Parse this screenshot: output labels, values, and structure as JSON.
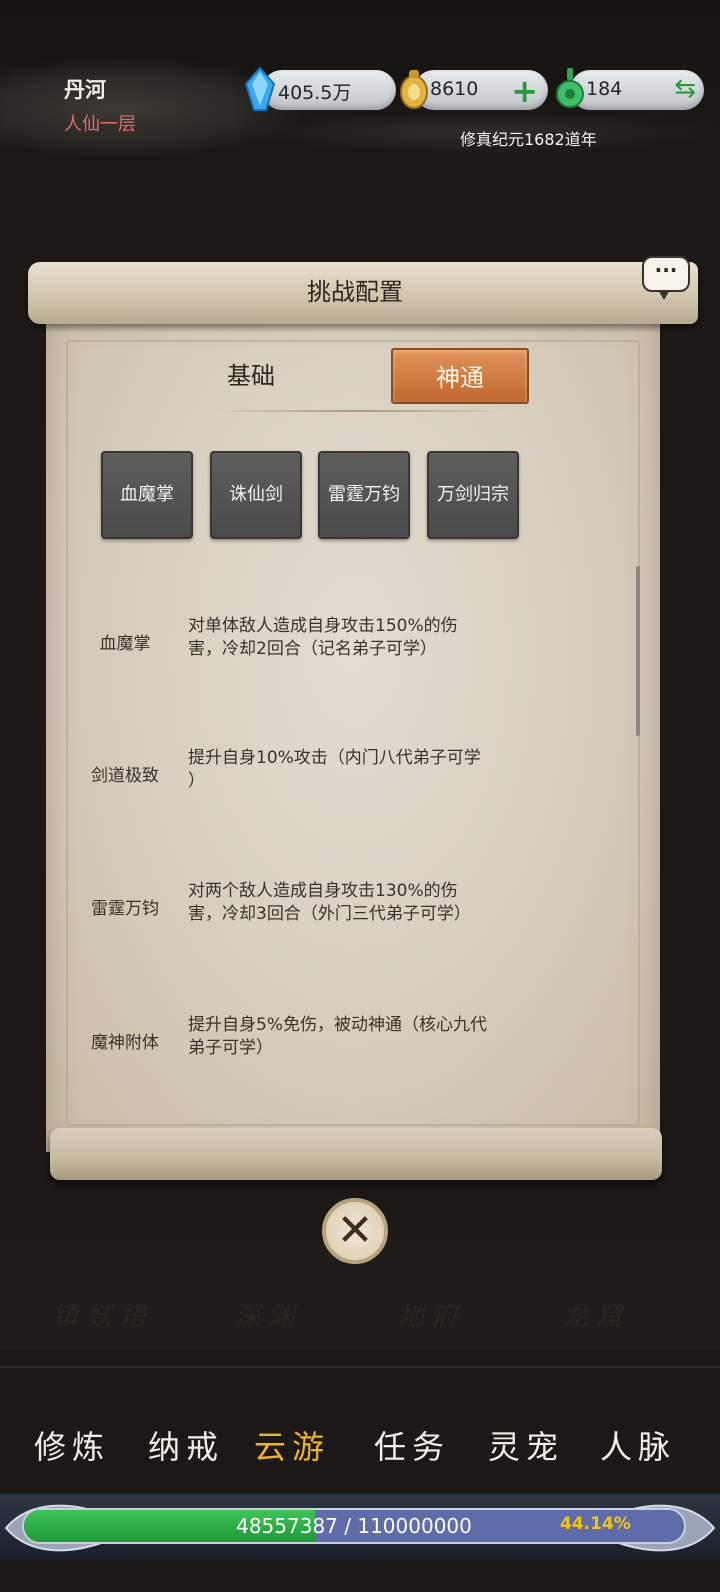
{
  "header": {
    "player_name": "丹河",
    "realm": "人仙一层",
    "era": "修真纪元1682道年",
    "resources": [
      {
        "name": "crystal",
        "value": "405.5万"
      },
      {
        "name": "gold-coin",
        "value": "8610",
        "action": "+"
      },
      {
        "name": "jade",
        "value": "184",
        "action": "⇆"
      }
    ]
  },
  "background_places": [
    "镇妖塔",
    "深渊",
    "地府",
    "龙窟"
  ],
  "dialog": {
    "title": "挑战配置",
    "tabs": [
      {
        "label": "基础",
        "active": false
      },
      {
        "label": "神通",
        "active": true
      }
    ],
    "slots": [
      "血魔掌",
      "诛仙剑",
      "雷霆万钧",
      "万剑归宗"
    ],
    "skills": [
      {
        "name": "血魔掌",
        "desc_line1": "对单体敌人造成自身攻击150%的伤",
        "desc_line2": "害，冷却2回合（记名弟子可学）"
      },
      {
        "name": "剑道极致",
        "desc_line1": "提升自身10%攻击（内门八代弟子可学",
        "desc_line2": "）"
      },
      {
        "name": "雷霆万钧",
        "desc_line1": "对两个敌人造成自身攻击130%的伤",
        "desc_line2": "害，冷却3回合（外门三代弟子可学）"
      },
      {
        "name": "魔神附体",
        "desc_line1": "提升自身5%免伤，被动神通（核心九代",
        "desc_line2": "弟子可学）"
      }
    ],
    "chat_icon": "···",
    "close_icon": "✕"
  },
  "nav": {
    "items": [
      {
        "label": "修炼",
        "active": false
      },
      {
        "label": "纳戒",
        "active": false
      },
      {
        "label": "云游",
        "active": true
      },
      {
        "label": "任务",
        "active": false
      },
      {
        "label": "灵宠",
        "active": false
      },
      {
        "label": "人脉",
        "active": false
      }
    ]
  },
  "exp": {
    "text": "48557387 / 110000000",
    "percent_label": "44.14%",
    "fraction": 0.4414
  },
  "colors": {
    "active_tab": "#d2793f",
    "active_nav": "#f0b429",
    "exp_fill": "#2fb048",
    "realm_text": "#e36b6b"
  }
}
